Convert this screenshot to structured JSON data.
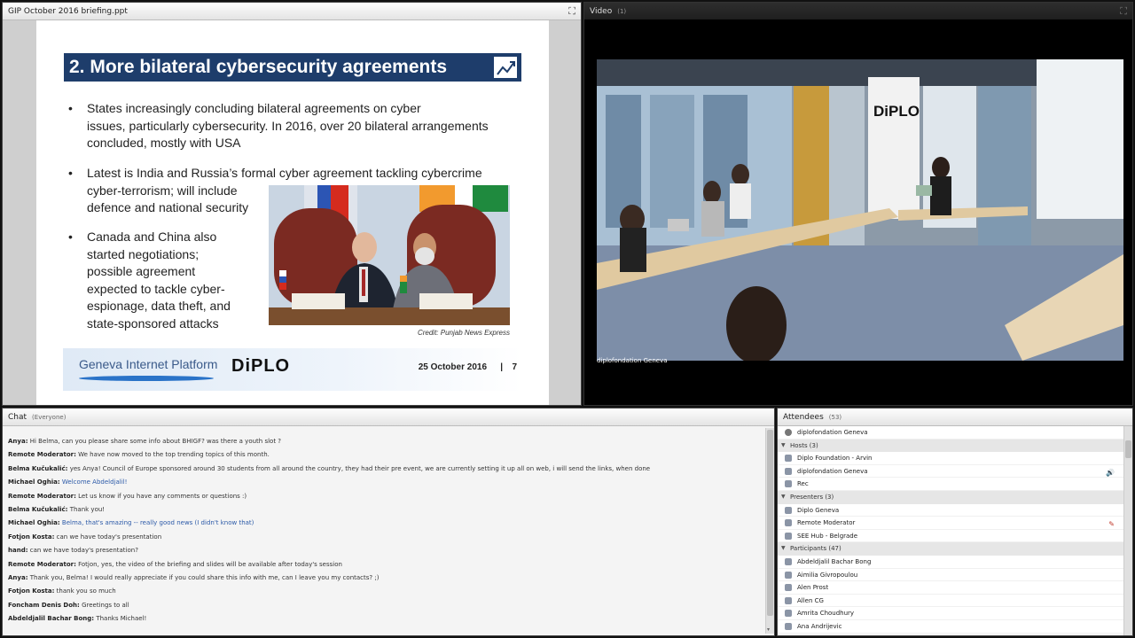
{
  "slide_pod": {
    "title": "GIP October 2016 briefing.ppt",
    "slide": {
      "title": "2. More bilateral cybersecurity agreements",
      "bullets": [
        "States increasingly concluding bilateral agreements on cyber issues, particularly cybersecurity. In 2016, over 20 bilateral arrangements concluded, mostly with USA",
        "Latest is India and Russia’s formal cyber agreement tackling cybercrime cyber-terrorism; will include defence and national security",
        "Canada and China also started negotiations; possible agreement expected to tackle cyber-espionage, data theft, and state-sponsored attacks"
      ],
      "bullet2_lines": [
        "Latest is India and Russia’s formal cyber agreement tackling cybercrime",
        "cyber-terrorism; will include",
        "defence and national security"
      ],
      "bullet3_lines": [
        "Canada and China also",
        "started negotiations;",
        "possible agreement",
        "expected to tackle cyber-",
        "espionage, data theft, and",
        "state-sponsored attacks"
      ],
      "bullet1_lines": [
        "States increasingly concluding bilateral agreements on cyber",
        "issues, particularly cybersecurity. In 2016, over 20 bilateral arrangements",
        "concluded, mostly with USA"
      ],
      "credit": "Credit: Punjab News Express",
      "footer_left": "Geneva Internet Platform",
      "footer_logo": "DiPLO",
      "date": "25 October 2016",
      "separator": "|",
      "page_number": "7"
    }
  },
  "video_pod": {
    "title": "Video",
    "sub": "(1)",
    "caption": "diplofondation Geneva",
    "banner_text": "DiPLO"
  },
  "chat_pod": {
    "title": "Chat",
    "sub": "(Everyone)",
    "messages": [
      {
        "who": "Anya:",
        "msg": "Hi Belma, can you please share some info about BHIGF? was there a youth slot ?",
        "blue": false
      },
      {
        "who": "Remote Moderator:",
        "msg": "We have now moved to the top trending topics of this month.",
        "blue": false
      },
      {
        "who": "Belma Kučukalić:",
        "msg": "yes Anya! Council of Europe sponsored around 30 students from all around the country, they had their pre event, we are currently setting it up all on web, i will send the links, when done",
        "blue": false
      },
      {
        "who": "Michael Oghia:",
        "msg": "Welcome Abdeldjalil!",
        "blue": true
      },
      {
        "who": "Remote Moderator:",
        "msg": "Let us know if you have any comments or questions :)",
        "blue": false
      },
      {
        "who": "Belma Kučukalić:",
        "msg": "Thank you!",
        "blue": false
      },
      {
        "who": "Michael Oghia:",
        "msg": "Belma, that's amazing -- really good news (I didn't know that)",
        "blue": true
      },
      {
        "who": "Fotjon Kosta:",
        "msg": "can we have today's presentation",
        "blue": false
      },
      {
        "who": "hand:",
        "msg": "can we have today's presentation?",
        "blue": false
      },
      {
        "who": "Remote Moderator:",
        "msg": "Fotjon, yes, the video of the briefing and slides will be available after today's session",
        "blue": false
      },
      {
        "who": "Anya:",
        "msg": "Thank you, Belma! I would really appreciate if you could share this info with me, can I leave you my contacts? ;)",
        "blue": false
      },
      {
        "who": "Fotjon Kosta:",
        "msg": "thank you so much",
        "blue": false
      },
      {
        "who": "Foncham Denis Doh:",
        "msg": "Greetings to all",
        "blue": false
      },
      {
        "who": "Abdeldjalil Bachar Bong:",
        "msg": "Thanks Michael!",
        "blue": false
      }
    ]
  },
  "attendees_pod": {
    "title": "Attendees",
    "count": "(53)",
    "top_user": "diplofondation Geneva",
    "groups": [
      {
        "label": "Hosts (3)",
        "members": [
          {
            "name": "Diplo Foundation - Arvin",
            "mic": ""
          },
          {
            "name": "diplofondation Geneva",
            "mic": "🔊"
          },
          {
            "name": "Rec",
            "mic": ""
          }
        ]
      },
      {
        "label": "Presenters (3)",
        "members": [
          {
            "name": "Diplo Geneva",
            "mic": ""
          },
          {
            "name": "Remote Moderator",
            "mic": "✎"
          },
          {
            "name": "SEE Hub - Belgrade",
            "mic": ""
          }
        ]
      },
      {
        "label": "Participants (47)",
        "members": [
          {
            "name": "Abdeldjalil Bachar Bong",
            "mic": ""
          },
          {
            "name": "Aimilia Givropoulou",
            "mic": ""
          },
          {
            "name": "Alen Prost",
            "mic": ""
          },
          {
            "name": "Allen CG",
            "mic": ""
          },
          {
            "name": "Amrita Choudhury",
            "mic": ""
          },
          {
            "name": "Ana Andrijevic",
            "mic": ""
          }
        ]
      }
    ]
  }
}
